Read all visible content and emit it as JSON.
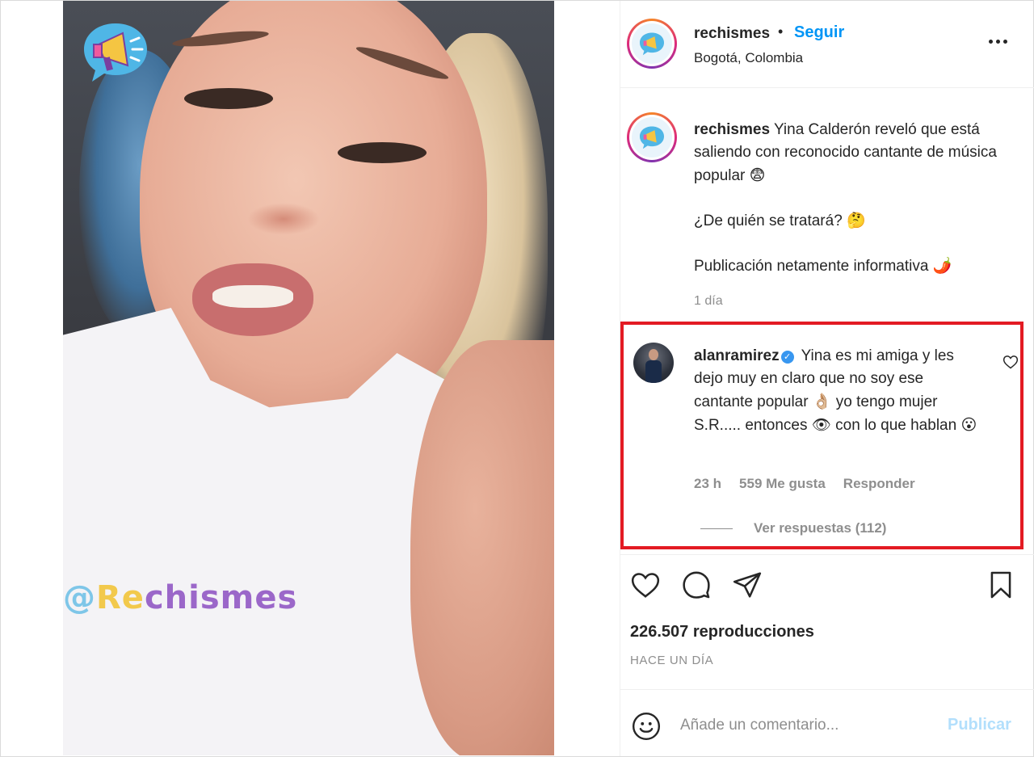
{
  "post": {
    "author": "rechismes",
    "follow_label": "Seguir",
    "separator": "•",
    "location": "Bogotá, Colombia",
    "watermark_at": "@",
    "watermark_re": "Re",
    "watermark_rest": "chismes"
  },
  "caption": {
    "username": "rechismes",
    "text": "Yina Calderón reveló que está saliendo con reconocido cantante de música popular",
    "emoji1": "😨",
    "question": "¿De quién se tratará?",
    "emoji2": "🤔",
    "disclaimer": "Publicación netamente informativa",
    "emoji3": "🌶️",
    "time": "1 día"
  },
  "comment": {
    "username": "alanramirez",
    "verified_mark": "✓",
    "text_a": "Yina es mi amiga y les dejo muy en claro que no soy ese cantante popular",
    "emoji_a": "👌🏼",
    "text_b": "yo tengo mujer S.R..... entonces",
    "emoji_b": "👁",
    "text_c": "con lo que hablan",
    "emoji_c": "😮",
    "time": "23 h",
    "likes": "559 Me gusta",
    "reply_label": "Responder",
    "view_replies": "Ver respuestas (112)",
    "highlight_color": "#e31b23"
  },
  "stats": {
    "views": "226.507 reproducciones",
    "posted_ago": "HACE UN DÍA"
  },
  "composer": {
    "placeholder": "Añade un comentario...",
    "publish_label": "Publicar"
  },
  "colors": {
    "link_blue": "#0095f6",
    "publish_disabled": "#b2dffc",
    "muted_text": "#8e8e8e"
  }
}
